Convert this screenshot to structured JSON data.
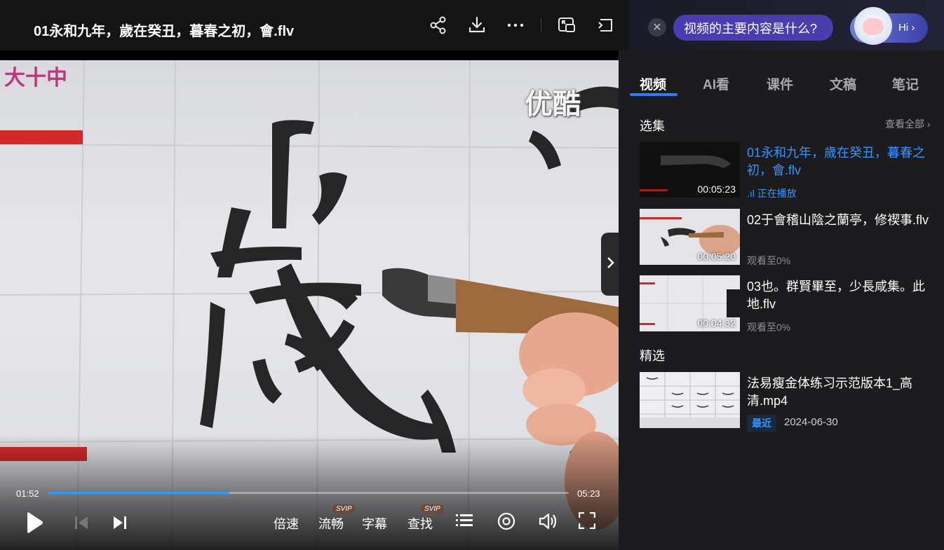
{
  "header": {
    "title": "01永和九年，歲在癸丑，暮春之初，會.flv"
  },
  "video": {
    "watermark_left": "大十中",
    "watermark_right": "优酷",
    "current_time": "01:52",
    "total_time": "05:23",
    "progress_fraction": 0.347
  },
  "controls": {
    "speed": "倍速",
    "quality": "流畅",
    "quality_badge": "SVIP",
    "subtitle": "字幕",
    "search": "查找",
    "search_badge": "SVIP"
  },
  "ai": {
    "prompt": "视频的主要内容是什么?",
    "hi": "Hi"
  },
  "tabs": [
    "视频",
    "AI看",
    "课件",
    "文稿",
    "笔记"
  ],
  "episodes": {
    "title": "选集",
    "see_all": "查看全部",
    "items": [
      {
        "title": "01永和九年，歲在癸丑，暮春之初，會.flv",
        "duration": "00:05:23",
        "status": "正在播放"
      },
      {
        "title": "02于會稽山陰之蘭亭，修禊事.flv",
        "duration": "00:05:20",
        "status": "观看至0%"
      },
      {
        "title": "03也。群賢畢至，少長咸集。此地.flv",
        "duration": "00:04:32",
        "status": "观看至0%"
      }
    ]
  },
  "featured": {
    "title": "精选",
    "items": [
      {
        "title": "法易瘦金体练习示范版本1_高清.mp4",
        "tag": "最近",
        "date": "2024-06-30"
      }
    ]
  },
  "colors": {
    "accent": "#2f95ff",
    "ai_pill": "#4a3db0"
  }
}
